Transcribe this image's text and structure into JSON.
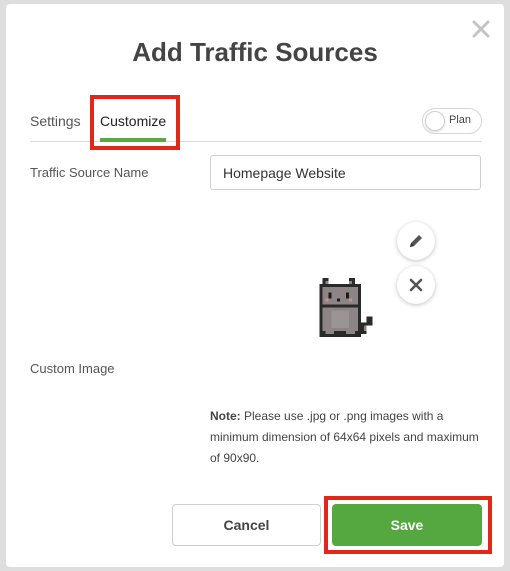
{
  "modal": {
    "title": "Add Traffic Sources",
    "close_icon": "close-icon"
  },
  "tabs": [
    {
      "label": "Settings",
      "active": false
    },
    {
      "label": "Customize",
      "active": true
    }
  ],
  "plan_toggle": {
    "label": "Plan",
    "on": false
  },
  "form": {
    "traffic_source_name": {
      "label": "Traffic Source Name",
      "value": "Homepage Website"
    },
    "custom_image": {
      "label": "Custom Image",
      "edit_icon": "pencil-icon",
      "remove_icon": "close-icon",
      "image": "pixel-cat-image"
    },
    "note": {
      "prefix": "Note:",
      "text": " Please use .jpg or .png images with a minimum dimension of 64x64 pixels and maximum of 90x90."
    }
  },
  "footer": {
    "cancel_label": "Cancel",
    "save_label": "Save"
  },
  "colors": {
    "accent": "#55a840",
    "highlight": "#e0271a"
  }
}
